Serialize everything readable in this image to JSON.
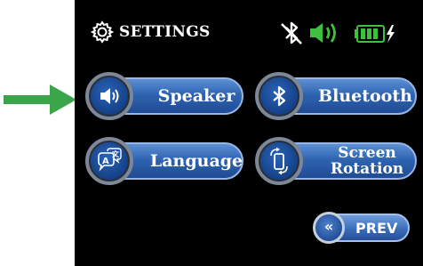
{
  "header": {
    "title": "SETTINGS",
    "icons": [
      "gear-icon",
      "bluetooth-off-icon",
      "volume-on-icon",
      "battery-charging-icon"
    ],
    "status_color": "#3fbf3f"
  },
  "buttons": {
    "speaker": {
      "label": "Speaker",
      "icon": "speaker-icon"
    },
    "bluetooth": {
      "label": "Bluetooth",
      "icon": "bluetooth-icon"
    },
    "language": {
      "label": "Language",
      "icon": "language-icon"
    },
    "screen_rotation": {
      "label_line1": "Screen",
      "label_line2": "Rotation",
      "icon": "screen-rotation-icon"
    },
    "prev": {
      "label": "PREV",
      "glyph": "«"
    }
  },
  "pointer": {
    "icon": "green-arrow-icon",
    "color": "#3aa54a"
  },
  "accent": "#2f64b2"
}
